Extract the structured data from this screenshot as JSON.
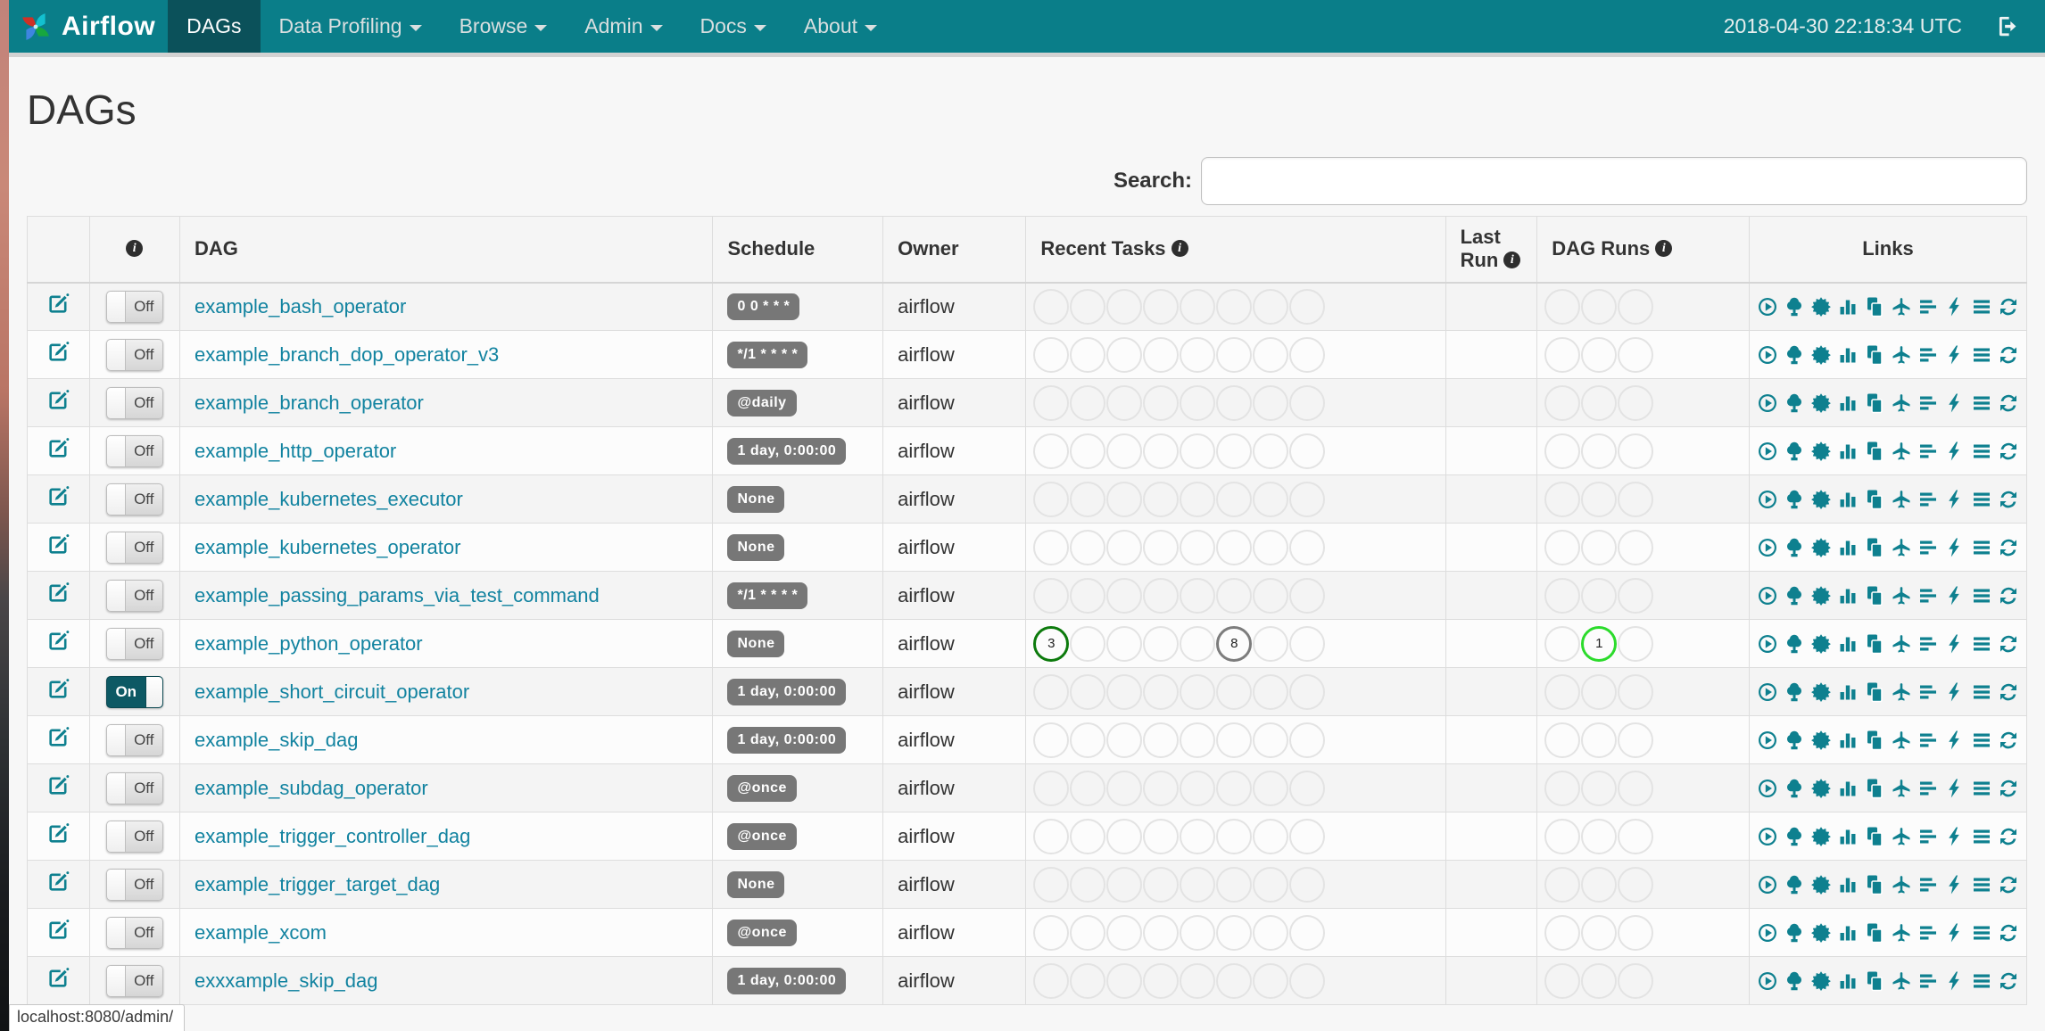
{
  "navbar": {
    "brand": "Airflow",
    "items": [
      {
        "label": "DAGs",
        "active": true,
        "caret": false
      },
      {
        "label": "Data Profiling",
        "active": false,
        "caret": true
      },
      {
        "label": "Browse",
        "active": false,
        "caret": true
      },
      {
        "label": "Admin",
        "active": false,
        "caret": true
      },
      {
        "label": "Docs",
        "active": false,
        "caret": true
      },
      {
        "label": "About",
        "active": false,
        "caret": true
      }
    ],
    "clock": "2018-04-30 22:18:34 UTC"
  },
  "page": {
    "title": "DAGs",
    "search_label": "Search:",
    "search_value": ""
  },
  "table": {
    "headers": {
      "dag": "DAG",
      "schedule": "Schedule",
      "owner": "Owner",
      "recent_tasks": "Recent Tasks",
      "last_run_line1": "Last",
      "last_run_line2": "Run",
      "dag_runs": "DAG Runs",
      "links": "Links"
    },
    "recent_task_slots": 8,
    "dag_run_slots": 3,
    "link_icons": [
      "trigger-dag",
      "tree-view",
      "graph-view",
      "task-duration",
      "task-tries",
      "landing-times",
      "gantt",
      "code",
      "task-instances",
      "refresh"
    ],
    "rows": [
      {
        "dag": "example_bash_operator",
        "schedule": "0 0 * * *",
        "owner": "airflow",
        "enabled": false,
        "toggle_label": "Off",
        "recent_tasks": [],
        "dag_runs": []
      },
      {
        "dag": "example_branch_dop_operator_v3",
        "schedule": "*/1 * * * *",
        "owner": "airflow",
        "enabled": false,
        "toggle_label": "Off",
        "recent_tasks": [],
        "dag_runs": []
      },
      {
        "dag": "example_branch_operator",
        "schedule": "@daily",
        "owner": "airflow",
        "enabled": false,
        "toggle_label": "Off",
        "recent_tasks": [],
        "dag_runs": []
      },
      {
        "dag": "example_http_operator",
        "schedule": "1 day, 0:00:00",
        "owner": "airflow",
        "enabled": false,
        "toggle_label": "Off",
        "recent_tasks": [],
        "dag_runs": []
      },
      {
        "dag": "example_kubernetes_executor",
        "schedule": "None",
        "owner": "airflow",
        "enabled": false,
        "toggle_label": "Off",
        "recent_tasks": [],
        "dag_runs": []
      },
      {
        "dag": "example_kubernetes_operator",
        "schedule": "None",
        "owner": "airflow",
        "enabled": false,
        "toggle_label": "Off",
        "recent_tasks": [],
        "dag_runs": []
      },
      {
        "dag": "example_passing_params_via_test_command",
        "schedule": "*/1 * * * *",
        "owner": "airflow",
        "enabled": false,
        "toggle_label": "Off",
        "recent_tasks": [],
        "dag_runs": []
      },
      {
        "dag": "example_python_operator",
        "schedule": "None",
        "owner": "airflow",
        "enabled": false,
        "toggle_label": "Off",
        "recent_tasks": [
          {
            "slot": 0,
            "count": "3",
            "state": "success"
          },
          {
            "slot": 5,
            "count": "8",
            "state": "queued"
          }
        ],
        "dag_runs": [
          {
            "slot": 1,
            "count": "1",
            "state": "running"
          }
        ]
      },
      {
        "dag": "example_short_circuit_operator",
        "schedule": "1 day, 0:00:00",
        "owner": "airflow",
        "enabled": true,
        "toggle_label": "On",
        "recent_tasks": [],
        "dag_runs": []
      },
      {
        "dag": "example_skip_dag",
        "schedule": "1 day, 0:00:00",
        "owner": "airflow",
        "enabled": false,
        "toggle_label": "Off",
        "recent_tasks": [],
        "dag_runs": []
      },
      {
        "dag": "example_subdag_operator",
        "schedule": "@once",
        "owner": "airflow",
        "enabled": false,
        "toggle_label": "Off",
        "recent_tasks": [],
        "dag_runs": []
      },
      {
        "dag": "example_trigger_controller_dag",
        "schedule": "@once",
        "owner": "airflow",
        "enabled": false,
        "toggle_label": "Off",
        "recent_tasks": [],
        "dag_runs": []
      },
      {
        "dag": "example_trigger_target_dag",
        "schedule": "None",
        "owner": "airflow",
        "enabled": false,
        "toggle_label": "Off",
        "recent_tasks": [],
        "dag_runs": []
      },
      {
        "dag": "example_xcom",
        "schedule": "@once",
        "owner": "airflow",
        "enabled": false,
        "toggle_label": "Off",
        "recent_tasks": [],
        "dag_runs": []
      },
      {
        "dag": "exxxample_skip_dag",
        "schedule": "1 day, 0:00:00",
        "owner": "airflow",
        "enabled": false,
        "toggle_label": "Off",
        "recent_tasks": [],
        "dag_runs": []
      }
    ]
  },
  "colors": {
    "navbar": "#0a7e89",
    "navbar_active": "#0b515a",
    "accent": "#0e808f",
    "badge": "#777777",
    "states": {
      "success": "#0c7a0c",
      "queued": "#7c7c7c",
      "running": "#2bdb2b"
    }
  },
  "statusbar": {
    "url": "localhost:8080/admin/"
  }
}
